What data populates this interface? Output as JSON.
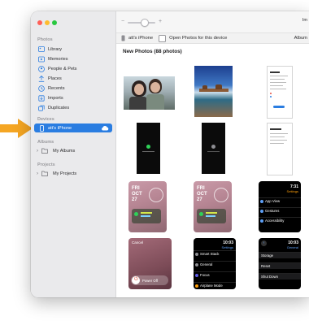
{
  "sidebar": {
    "sections": {
      "photos": "Photos",
      "devices": "Devices",
      "albums": "Albums",
      "projects": "Projects"
    },
    "photos_items": [
      {
        "label": "Library",
        "icon": "library-icon"
      },
      {
        "label": "Memories",
        "icon": "memories-icon"
      },
      {
        "label": "People & Pets",
        "icon": "people-icon"
      },
      {
        "label": "Places",
        "icon": "places-icon"
      },
      {
        "label": "Recents",
        "icon": "recents-icon"
      },
      {
        "label": "Imports",
        "icon": "imports-icon"
      },
      {
        "label": "Duplicates",
        "icon": "duplicates-icon"
      }
    ],
    "device_item": {
      "label": "att's iPhone",
      "selected": true
    },
    "albums_item": {
      "label": "My Albums"
    },
    "projects_item": {
      "label": "My Projects"
    }
  },
  "toolbar": {
    "zoom_minus": "−",
    "zoom_plus": "+",
    "right_text": "Im"
  },
  "device_bar": {
    "device_name": "att's iPhone",
    "open_photos_label": "Open Photos for this device",
    "album_label": "Album"
  },
  "main": {
    "heading": "New Photos (88 photos)"
  },
  "watch": {
    "day": "FRI",
    "month": "OCT",
    "date": "27"
  },
  "watch_menu_1": {
    "time": "7:31",
    "sub": "Settings",
    "items": [
      "App View",
      "Gestures",
      "Accessibility"
    ]
  },
  "power_screen": {
    "cancel": "Cancel",
    "power_off": "Power Off"
  },
  "watch_menu_2": {
    "time": "10:03",
    "sub": "Settings",
    "items": [
      "Smart Stack",
      "General",
      "Focus",
      "Airplane Mode"
    ]
  },
  "watch_menu_3": {
    "time": "10:03",
    "sub": "General",
    "items": [
      "Storage",
      "Reset",
      "Shut Down"
    ]
  },
  "colors": {
    "accent": "#2a7de1",
    "sidebar_bg": "#eaeaec",
    "arrow": "#f5a623"
  }
}
